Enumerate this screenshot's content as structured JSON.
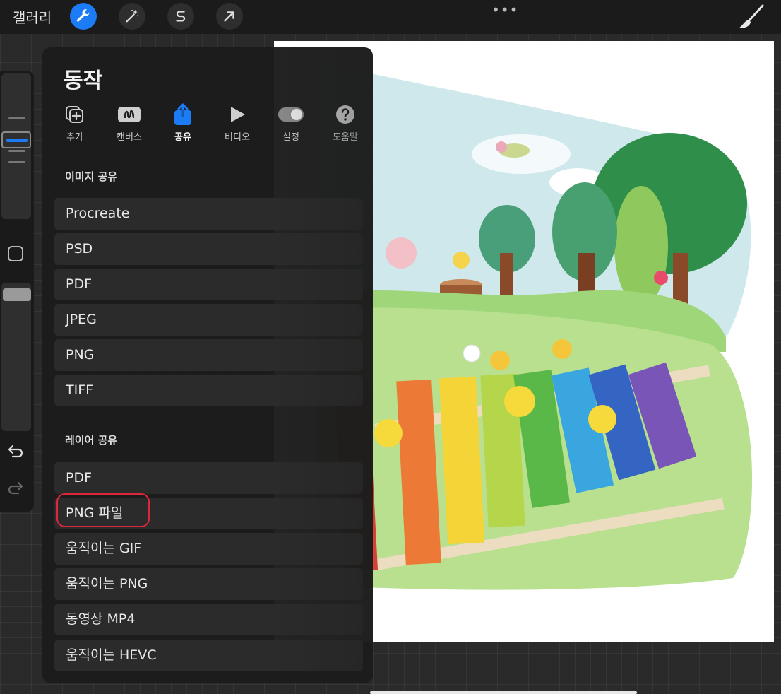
{
  "topbar": {
    "gallery_label": "갤러리",
    "tools": [
      {
        "name": "wrench-icon",
        "active": true
      },
      {
        "name": "magic-wand-icon",
        "active": false
      },
      {
        "name": "selection-s-icon",
        "active": false
      },
      {
        "name": "arrow-transform-icon",
        "active": false
      }
    ],
    "more_label": "•••",
    "brush_icon": "paintbrush-icon"
  },
  "actions": {
    "title": "동작",
    "tabs": [
      {
        "label": "추가",
        "icon": "add-image-icon",
        "active": false
      },
      {
        "label": "캔버스",
        "icon": "canvas-icon",
        "active": false
      },
      {
        "label": "공유",
        "icon": "share-icon",
        "active": true
      },
      {
        "label": "비디오",
        "icon": "play-icon",
        "active": false
      },
      {
        "label": "설정",
        "icon": "toggle-icon",
        "active": false
      },
      {
        "label": "도움말",
        "icon": "help-icon",
        "active": false
      }
    ],
    "image_share": {
      "label": "이미지 공유",
      "options": [
        "Procreate",
        "PSD",
        "PDF",
        "JPEG",
        "PNG",
        "TIFF"
      ]
    },
    "layer_share": {
      "label": "레이어 공유",
      "options": [
        "PDF",
        "PNG 파일",
        "움직이는 GIF",
        "움직이는 PNG",
        "동영상 MP4",
        "움직이는 HEVC"
      ]
    },
    "highlighted_option": "PNG 파일"
  },
  "colors": {
    "accent": "#1b7cf6",
    "highlight": "#e0263b",
    "panel_bg": "#1c1c1c",
    "option_bg": "#2b2b2b"
  }
}
